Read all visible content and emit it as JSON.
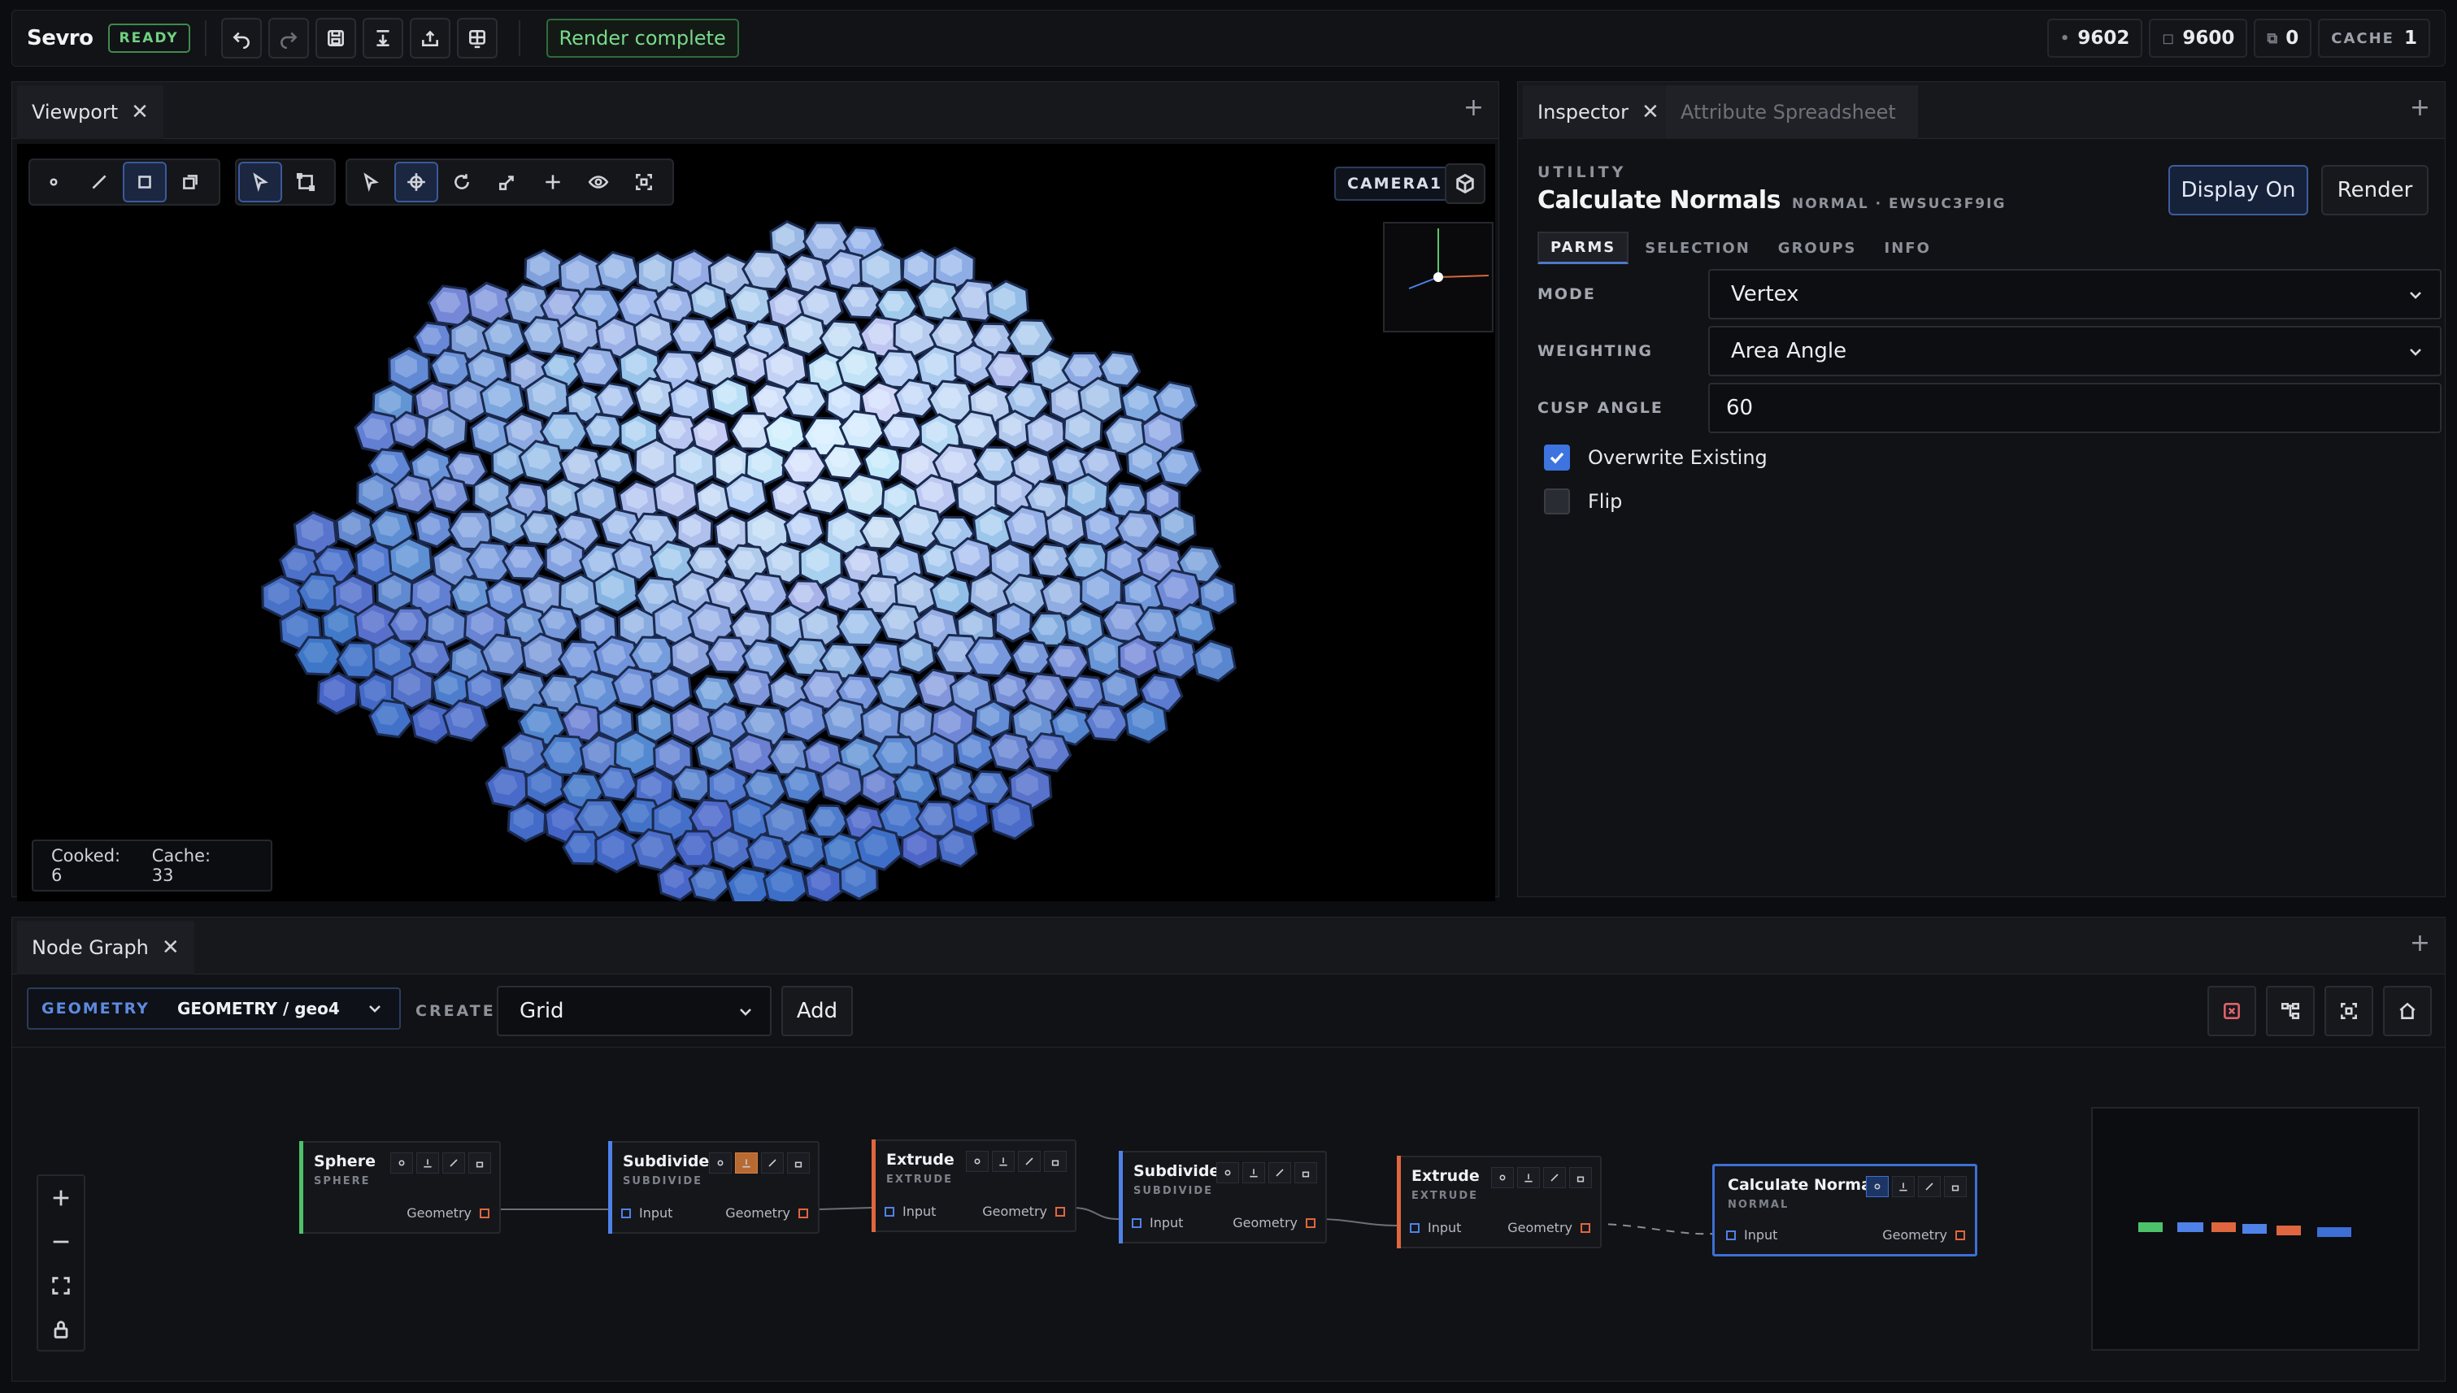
{
  "app": {
    "title": "Sevro",
    "status_badge": "READY",
    "render_status": "Render complete"
  },
  "toolbar": {
    "actions": [
      "undo-icon",
      "redo-icon",
      "save-icon",
      "import-icon",
      "export-icon",
      "layout-icon"
    ],
    "stats": [
      {
        "icon": "points-icon",
        "glyph": "•",
        "value": "9602"
      },
      {
        "icon": "primitives-icon",
        "glyph": "◻",
        "value": "9600"
      },
      {
        "icon": "errors-icon",
        "glyph": "⧉",
        "value": "0"
      }
    ],
    "cache_label": "CACHE",
    "cache_value": "1"
  },
  "viewport": {
    "tab_label": "Viewport",
    "camera_label": "CAMERA1",
    "cooked_text": "Cooked: 6",
    "cache_text": "Cache: 33",
    "mesh_color": "#7fa6ee"
  },
  "inspector": {
    "tabs": [
      "Inspector",
      "Attribute Spreadsheet"
    ],
    "category": "UTILITY",
    "node_name": "Calculate Normals",
    "node_meta": "NORMAL · EWSUC3F9IG",
    "display_button": "Display On",
    "render_button": "Render",
    "subtabs": [
      "PARMS",
      "SELECTION",
      "GROUPS",
      "INFO"
    ],
    "params": {
      "mode_label": "MODE",
      "mode_value": "Vertex",
      "weighting_label": "WEIGHTING",
      "weighting_value": "Area Angle",
      "cusp_label": "CUSP ANGLE",
      "cusp_value": "60"
    },
    "checks": [
      {
        "label": "Overwrite Existing",
        "checked": true
      },
      {
        "label": "Flip",
        "checked": false
      }
    ]
  },
  "node_graph": {
    "tab_label": "Node Graph",
    "context_key": "GEOMETRY",
    "context_path": "GEOMETRY / geo4",
    "create_label": "CREATE",
    "create_value": "Grid",
    "add_button": "Add",
    "port_in": "Input",
    "port_out": "Geometry",
    "nodes": [
      {
        "name": "Sphere",
        "type": "SPHERE",
        "color": "#4cc36a"
      },
      {
        "name": "Subdivide",
        "type": "SUBDIVIDE",
        "color": "#4f82e8"
      },
      {
        "name": "Extrude",
        "type": "EXTRUDE",
        "color": "#e0663f"
      },
      {
        "name": "Subdivide",
        "type": "SUBDIVIDE",
        "color": "#4f82e8"
      },
      {
        "name": "Extrude",
        "type": "EXTRUDE",
        "color": "#e0663f"
      },
      {
        "name": "Calculate Normals",
        "type": "NORMAL",
        "color": "#3d6fd6"
      }
    ]
  }
}
